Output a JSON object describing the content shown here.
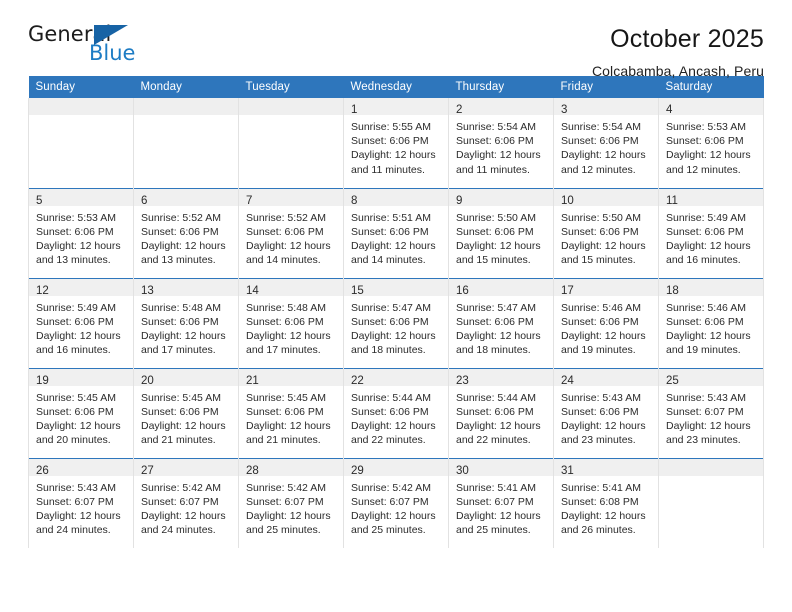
{
  "logo": {
    "word_one": "General",
    "word_two": "Blue",
    "triangle_color": "#1763a5",
    "blue_color": "#1d7cc4"
  },
  "header": {
    "title": "October 2025",
    "subtitle": "Colcabamba, Ancash, Peru"
  },
  "theme": {
    "header_blue": "#2e76bc",
    "daynum_band": "#f0f0f0",
    "cell_border": "#e2e2e2"
  },
  "calendar": {
    "weekday_headers": [
      "Sunday",
      "Monday",
      "Tuesday",
      "Wednesday",
      "Thursday",
      "Friday",
      "Saturday"
    ],
    "labels": {
      "sunrise": "Sunrise:",
      "sunset": "Sunset:",
      "daylight": "Daylight:"
    },
    "weeks": [
      [
        {
          "day": "",
          "empty": true
        },
        {
          "day": "",
          "empty": true
        },
        {
          "day": "",
          "empty": true
        },
        {
          "day": "1",
          "sunrise": "Sunrise: 5:55 AM",
          "sunset": "Sunset: 6:06 PM",
          "daylight": "Daylight: 12 hours and 11 minutes."
        },
        {
          "day": "2",
          "sunrise": "Sunrise: 5:54 AM",
          "sunset": "Sunset: 6:06 PM",
          "daylight": "Daylight: 12 hours and 11 minutes."
        },
        {
          "day": "3",
          "sunrise": "Sunrise: 5:54 AM",
          "sunset": "Sunset: 6:06 PM",
          "daylight": "Daylight: 12 hours and 12 minutes."
        },
        {
          "day": "4",
          "sunrise": "Sunrise: 5:53 AM",
          "sunset": "Sunset: 6:06 PM",
          "daylight": "Daylight: 12 hours and 12 minutes."
        }
      ],
      [
        {
          "day": "5",
          "sunrise": "Sunrise: 5:53 AM",
          "sunset": "Sunset: 6:06 PM",
          "daylight": "Daylight: 12 hours and 13 minutes."
        },
        {
          "day": "6",
          "sunrise": "Sunrise: 5:52 AM",
          "sunset": "Sunset: 6:06 PM",
          "daylight": "Daylight: 12 hours and 13 minutes."
        },
        {
          "day": "7",
          "sunrise": "Sunrise: 5:52 AM",
          "sunset": "Sunset: 6:06 PM",
          "daylight": "Daylight: 12 hours and 14 minutes."
        },
        {
          "day": "8",
          "sunrise": "Sunrise: 5:51 AM",
          "sunset": "Sunset: 6:06 PM",
          "daylight": "Daylight: 12 hours and 14 minutes."
        },
        {
          "day": "9",
          "sunrise": "Sunrise: 5:50 AM",
          "sunset": "Sunset: 6:06 PM",
          "daylight": "Daylight: 12 hours and 15 minutes."
        },
        {
          "day": "10",
          "sunrise": "Sunrise: 5:50 AM",
          "sunset": "Sunset: 6:06 PM",
          "daylight": "Daylight: 12 hours and 15 minutes."
        },
        {
          "day": "11",
          "sunrise": "Sunrise: 5:49 AM",
          "sunset": "Sunset: 6:06 PM",
          "daylight": "Daylight: 12 hours and 16 minutes."
        }
      ],
      [
        {
          "day": "12",
          "sunrise": "Sunrise: 5:49 AM",
          "sunset": "Sunset: 6:06 PM",
          "daylight": "Daylight: 12 hours and 16 minutes."
        },
        {
          "day": "13",
          "sunrise": "Sunrise: 5:48 AM",
          "sunset": "Sunset: 6:06 PM",
          "daylight": "Daylight: 12 hours and 17 minutes."
        },
        {
          "day": "14",
          "sunrise": "Sunrise: 5:48 AM",
          "sunset": "Sunset: 6:06 PM",
          "daylight": "Daylight: 12 hours and 17 minutes."
        },
        {
          "day": "15",
          "sunrise": "Sunrise: 5:47 AM",
          "sunset": "Sunset: 6:06 PM",
          "daylight": "Daylight: 12 hours and 18 minutes."
        },
        {
          "day": "16",
          "sunrise": "Sunrise: 5:47 AM",
          "sunset": "Sunset: 6:06 PM",
          "daylight": "Daylight: 12 hours and 18 minutes."
        },
        {
          "day": "17",
          "sunrise": "Sunrise: 5:46 AM",
          "sunset": "Sunset: 6:06 PM",
          "daylight": "Daylight: 12 hours and 19 minutes."
        },
        {
          "day": "18",
          "sunrise": "Sunrise: 5:46 AM",
          "sunset": "Sunset: 6:06 PM",
          "daylight": "Daylight: 12 hours and 19 minutes."
        }
      ],
      [
        {
          "day": "19",
          "sunrise": "Sunrise: 5:45 AM",
          "sunset": "Sunset: 6:06 PM",
          "daylight": "Daylight: 12 hours and 20 minutes."
        },
        {
          "day": "20",
          "sunrise": "Sunrise: 5:45 AM",
          "sunset": "Sunset: 6:06 PM",
          "daylight": "Daylight: 12 hours and 21 minutes."
        },
        {
          "day": "21",
          "sunrise": "Sunrise: 5:45 AM",
          "sunset": "Sunset: 6:06 PM",
          "daylight": "Daylight: 12 hours and 21 minutes."
        },
        {
          "day": "22",
          "sunrise": "Sunrise: 5:44 AM",
          "sunset": "Sunset: 6:06 PM",
          "daylight": "Daylight: 12 hours and 22 minutes."
        },
        {
          "day": "23",
          "sunrise": "Sunrise: 5:44 AM",
          "sunset": "Sunset: 6:06 PM",
          "daylight": "Daylight: 12 hours and 22 minutes."
        },
        {
          "day": "24",
          "sunrise": "Sunrise: 5:43 AM",
          "sunset": "Sunset: 6:06 PM",
          "daylight": "Daylight: 12 hours and 23 minutes."
        },
        {
          "day": "25",
          "sunrise": "Sunrise: 5:43 AM",
          "sunset": "Sunset: 6:07 PM",
          "daylight": "Daylight: 12 hours and 23 minutes."
        }
      ],
      [
        {
          "day": "26",
          "sunrise": "Sunrise: 5:43 AM",
          "sunset": "Sunset: 6:07 PM",
          "daylight": "Daylight: 12 hours and 24 minutes."
        },
        {
          "day": "27",
          "sunrise": "Sunrise: 5:42 AM",
          "sunset": "Sunset: 6:07 PM",
          "daylight": "Daylight: 12 hours and 24 minutes."
        },
        {
          "day": "28",
          "sunrise": "Sunrise: 5:42 AM",
          "sunset": "Sunset: 6:07 PM",
          "daylight": "Daylight: 12 hours and 25 minutes."
        },
        {
          "day": "29",
          "sunrise": "Sunrise: 5:42 AM",
          "sunset": "Sunset: 6:07 PM",
          "daylight": "Daylight: 12 hours and 25 minutes."
        },
        {
          "day": "30",
          "sunrise": "Sunrise: 5:41 AM",
          "sunset": "Sunset: 6:07 PM",
          "daylight": "Daylight: 12 hours and 25 minutes."
        },
        {
          "day": "31",
          "sunrise": "Sunrise: 5:41 AM",
          "sunset": "Sunset: 6:08 PM",
          "daylight": "Daylight: 12 hours and 26 minutes."
        },
        {
          "day": "",
          "empty": true
        }
      ]
    ]
  }
}
